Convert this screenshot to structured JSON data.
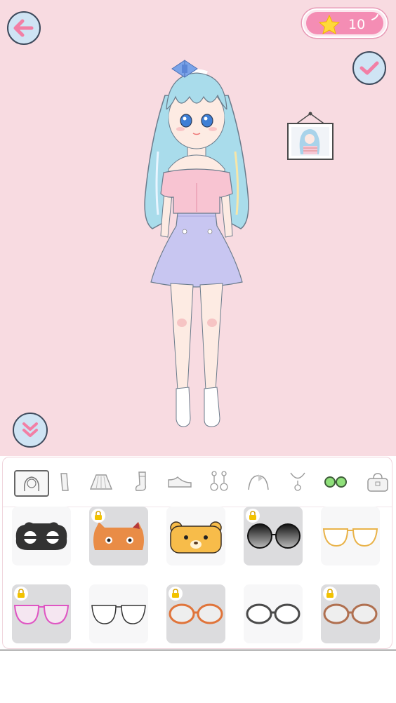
{
  "header": {
    "back_button_icon": "back-arrow-icon",
    "confirm_button_icon": "checkmark-icon",
    "collapse_button_icon": "double-chevron-down-icon",
    "stars": {
      "icon": "star-icon",
      "count": "10"
    }
  },
  "character": {
    "description_icon": "dressed-character",
    "photo_frame_icon": "framed-portrait-icon"
  },
  "colors": {
    "stage_background": "#f8dbe1",
    "button_fill": "#cfe4f4",
    "accent_pink": "#f48db4",
    "arrow_pink": "#f27fa5",
    "active_tab_green": "#8fe07a"
  },
  "category_tabs": [
    {
      "icon": "hairstyle-icon",
      "active": false
    },
    {
      "icon": "top-icon",
      "active": false
    },
    {
      "icon": "skirt-icon",
      "active": false
    },
    {
      "icon": "sock-icon",
      "active": false
    },
    {
      "icon": "shoe-icon",
      "active": false
    },
    {
      "icon": "earring-icon",
      "active": false
    },
    {
      "icon": "headband-icon",
      "active": false
    },
    {
      "icon": "necklace-icon",
      "active": false
    },
    {
      "icon": "glasses-icon",
      "active": true
    },
    {
      "icon": "bag-icon",
      "active": false
    }
  ],
  "items": [
    {
      "icon": "black-sleep-mask-icon",
      "locked": false
    },
    {
      "icon": "orange-cat-mask-icon",
      "locked": true
    },
    {
      "icon": "bear-mask-icon",
      "locked": false
    },
    {
      "icon": "round-sunglasses-icon",
      "locked": true
    },
    {
      "icon": "gold-aviator-glasses-icon",
      "locked": false
    },
    {
      "icon": "pink-aviator-glasses-icon",
      "locked": true
    },
    {
      "icon": "white-aviator-glasses-icon",
      "locked": false
    },
    {
      "icon": "orange-round-glasses-icon",
      "locked": true
    },
    {
      "icon": "grey-round-glasses-icon",
      "locked": false
    },
    {
      "icon": "brown-round-glasses-icon",
      "locked": true
    }
  ]
}
